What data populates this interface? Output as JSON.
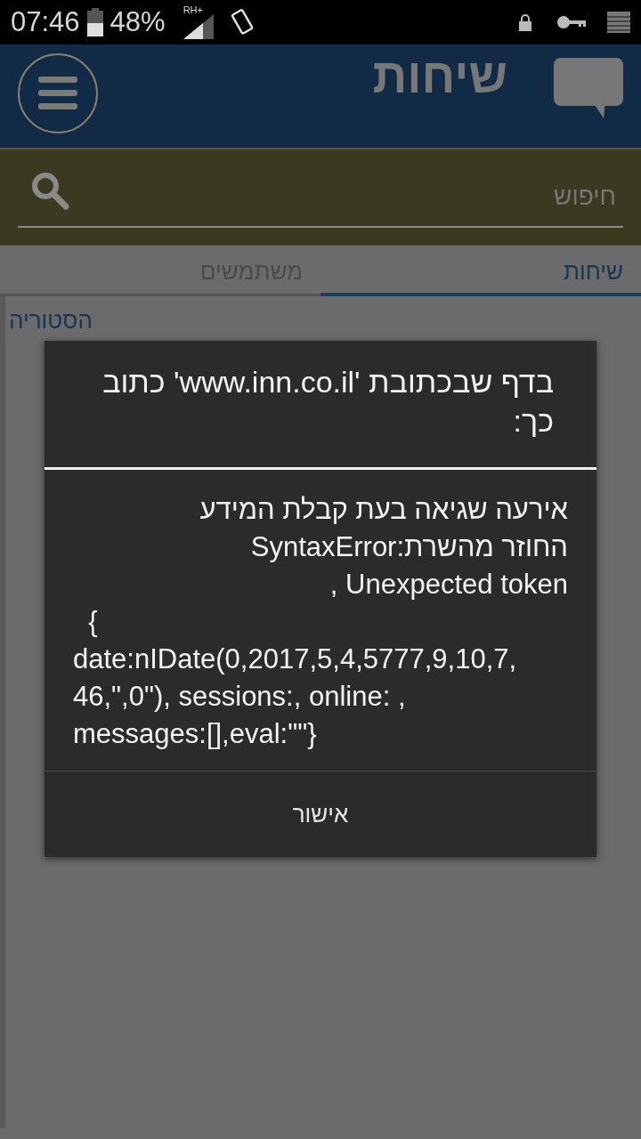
{
  "status_bar": {
    "time": "07:46",
    "battery": "48%",
    "network_label": "RH+"
  },
  "header": {
    "title": "שיחות"
  },
  "search": {
    "placeholder": "חיפוש"
  },
  "tabs": [
    {
      "label": "שיחות",
      "selected": true
    },
    {
      "label": "משתמשים",
      "selected": false
    }
  ],
  "history_link": "הסטוריה",
  "dialog": {
    "title": "בדף שבכתובת 'www.inn.co.il' כתוב כך:",
    "message_lines": [
      {
        "text": "אירעה שגיאה בעת קבלת המידע",
        "kind": "rtl"
      },
      {
        "text": "החוזר מהשרת:SyntaxError",
        "kind": "rtl"
      },
      {
        "text": "Unexpected token ,",
        "kind": "rtl"
      },
      {
        "text": "  {",
        "kind": "ltr"
      },
      {
        "text": "date:nIDate(0,2017,5,4,5777,9,10,7,",
        "kind": "ltr"
      },
      {
        "text": "46,\",0\"), sessions:, online: ,",
        "kind": "ltr"
      },
      {
        "text": "messages:[],eval:\"\"}",
        "kind": "ltr"
      }
    ],
    "button": "אישור"
  }
}
